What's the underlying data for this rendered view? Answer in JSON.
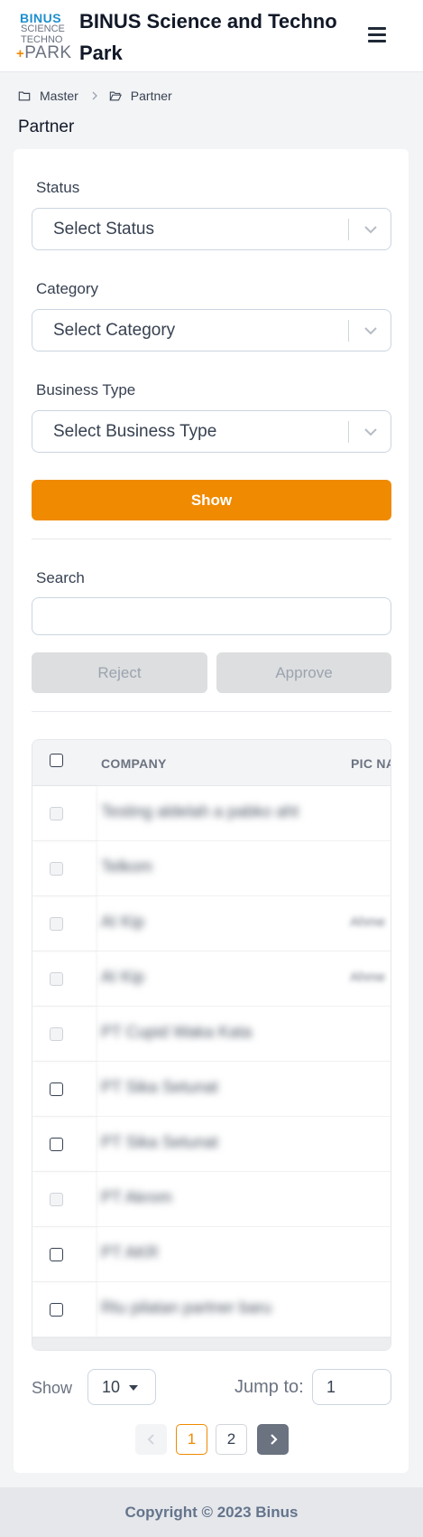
{
  "header": {
    "logo_line1": "BINUS",
    "logo_line2": "SCIENCE",
    "logo_line3": "TECHNO",
    "logo_line4": "PARK",
    "app_title": "BINUS Science and Techno Park",
    "menu_icon": "hamburger-icon"
  },
  "breadcrumb": {
    "items": [
      "Master",
      "Partner"
    ],
    "icons": [
      "folder-icon",
      "folder-open-icon"
    ],
    "separator_icon": "chevron-right-icon"
  },
  "page_title": "Partner",
  "filters": {
    "status_label": "Status",
    "status_placeholder": "Select Status",
    "category_label": "Category",
    "category_placeholder": "Select Category",
    "business_type_label": "Business Type",
    "business_type_placeholder": "Select Business Type",
    "show_button": "Show"
  },
  "search": {
    "label": "Search",
    "value": ""
  },
  "actions": {
    "reject_button": "Reject",
    "approve_button": "Approve"
  },
  "table": {
    "columns": [
      "COMPANY",
      "PIC NA"
    ],
    "rows": [
      {
        "company": "Testing aldelah a pabko aht",
        "pic": "",
        "checkbox_enabled": false
      },
      {
        "company": "Telkom",
        "pic": "",
        "checkbox_enabled": false
      },
      {
        "company": "AI Kip",
        "pic": "Ahme",
        "checkbox_enabled": false
      },
      {
        "company": "AI Kip",
        "pic": "Ahme",
        "checkbox_enabled": false
      },
      {
        "company": "PT Cupid Waka Kata",
        "pic": "",
        "checkbox_enabled": false
      },
      {
        "company": "PT Sika Setunat",
        "pic": "",
        "checkbox_enabled": true
      },
      {
        "company": "PT Sika Setunat",
        "pic": "",
        "checkbox_enabled": true
      },
      {
        "company": "PT Akrom",
        "pic": "",
        "checkbox_enabled": false
      },
      {
        "company": "PT AKR",
        "pic": "",
        "checkbox_enabled": true
      },
      {
        "company": "Rtu pilatan partner baru",
        "pic": "",
        "checkbox_enabled": true
      }
    ]
  },
  "pagination": {
    "show_label": "Show",
    "page_size": "10",
    "jump_label": "Jump to:",
    "jump_value": "1",
    "pages": [
      "1",
      "2"
    ],
    "current_page": "1"
  },
  "footer": {
    "copyright": "Copyright © 2023 Binus"
  },
  "colors": {
    "accent": "#f08a00",
    "logo_blue": "#1d8fcf",
    "footer_bg": "#e5e7eb"
  }
}
